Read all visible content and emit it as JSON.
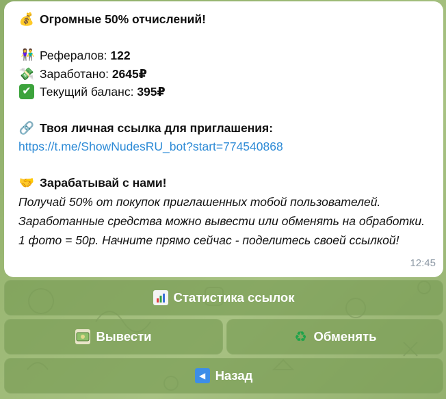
{
  "message": {
    "title": "Огромные 50% отчислений!",
    "referrals_label": "Рефералов:",
    "referrals_value": "122",
    "earned_label": "Заработано:",
    "earned_value": "2645₽",
    "balance_label": "Текущий баланс:",
    "balance_value": "395₽",
    "link_heading": "Твоя личная ссылка для приглашения:",
    "link_url": "https://t.me/ShowNudesRU_bot?start=774540868",
    "earn_heading": "Зарабатывай с нами!",
    "earn_text": "Получай 50% от покупок приглашенных тобой пользователей. Заработанные средства можно вывести или обменять на обработки. 1 фото = 50р. Начните прямо сейчас - поделитесь своей ссылкой!",
    "time": "12:45"
  },
  "keyboard": {
    "stats_label": "Статистика ссылок",
    "withdraw_label": "Вывести",
    "exchange_label": "Обменять",
    "back_label": "Назад"
  },
  "icons": {
    "title": "money-bag-icon",
    "referrals": "people-icon",
    "earned": "money-wings-icon",
    "balance": "check-mark-icon",
    "link": "link-icon",
    "earn": "handshake-icon",
    "stats": "bar-chart-icon",
    "withdraw": "banknote-icon",
    "exchange": "recycle-icon",
    "back": "back-arrow-icon"
  },
  "colors": {
    "link": "#2c8ad6",
    "time": "#8e9aa6",
    "button_bg": "#7b9e58",
    "check": "#3ca33c"
  }
}
